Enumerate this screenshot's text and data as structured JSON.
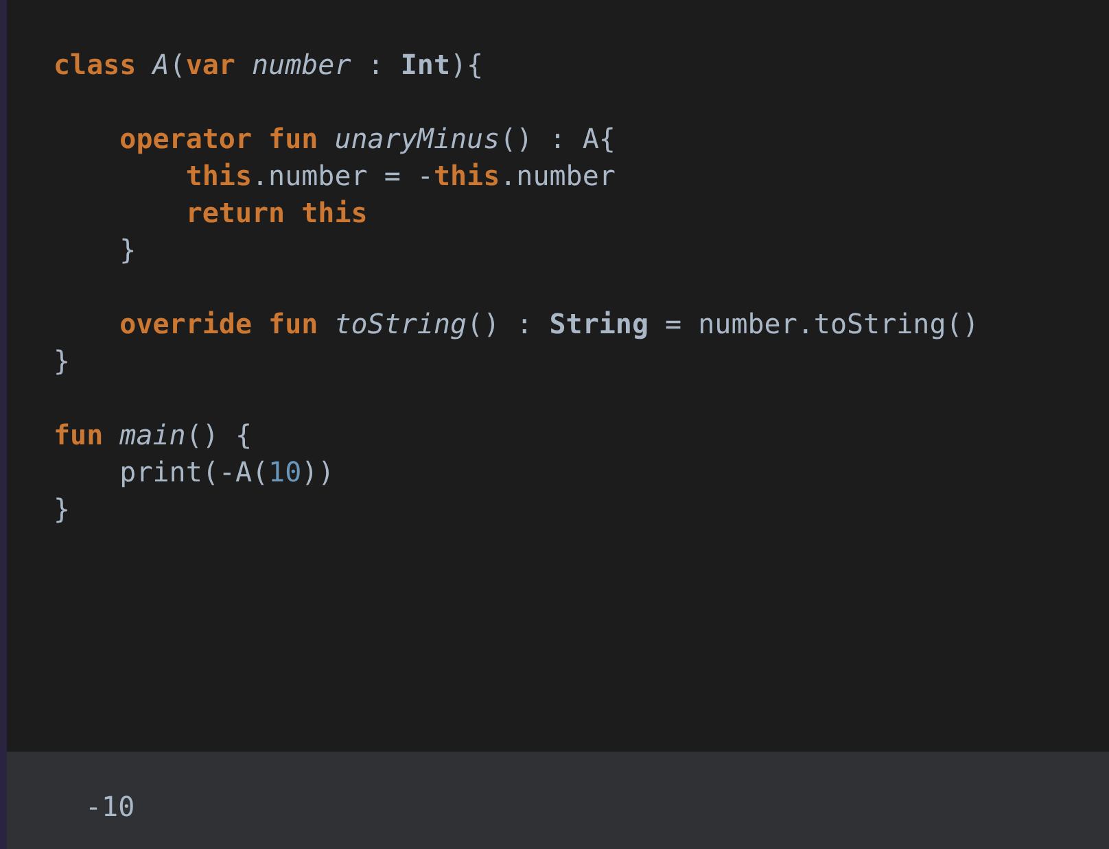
{
  "code": {
    "lines": [
      {
        "kind": "code",
        "tokens": [
          {
            "text": "class ",
            "kind": "keyword"
          },
          {
            "text": "A",
            "kind": "italic"
          },
          {
            "text": "(",
            "kind": "plain"
          },
          {
            "text": "var ",
            "kind": "keyword"
          },
          {
            "text": "number",
            "kind": "italic"
          },
          {
            "text": " : ",
            "kind": "plain"
          },
          {
            "text": "Int",
            "kind": "type"
          },
          {
            "text": "){",
            "kind": "plain"
          }
        ]
      },
      {
        "kind": "blank"
      },
      {
        "kind": "code",
        "tokens": [
          {
            "text": "    operator fun ",
            "kind": "keyword"
          },
          {
            "text": "unaryMinus",
            "kind": "italic"
          },
          {
            "text": "() : A{",
            "kind": "plain"
          }
        ]
      },
      {
        "kind": "code",
        "tokens": [
          {
            "text": "        this",
            "kind": "keyword"
          },
          {
            "text": ".number = -",
            "kind": "plain"
          },
          {
            "text": "this",
            "kind": "keyword"
          },
          {
            "text": ".number",
            "kind": "plain"
          }
        ]
      },
      {
        "kind": "code",
        "tokens": [
          {
            "text": "        return this",
            "kind": "keyword"
          }
        ]
      },
      {
        "kind": "code",
        "tokens": [
          {
            "text": "    }",
            "kind": "plain"
          }
        ]
      },
      {
        "kind": "blank"
      },
      {
        "kind": "code",
        "tokens": [
          {
            "text": "    override fun ",
            "kind": "keyword"
          },
          {
            "text": "toString",
            "kind": "italic"
          },
          {
            "text": "() : ",
            "kind": "plain"
          },
          {
            "text": "String",
            "kind": "type"
          },
          {
            "text": " = number.toString()",
            "kind": "plain"
          }
        ]
      },
      {
        "kind": "code",
        "tokens": [
          {
            "text": "}",
            "kind": "plain"
          }
        ]
      },
      {
        "kind": "blank"
      },
      {
        "kind": "code",
        "tokens": [
          {
            "text": "fun ",
            "kind": "keyword"
          },
          {
            "text": "main",
            "kind": "italic"
          },
          {
            "text": "() {",
            "kind": "plain"
          }
        ]
      },
      {
        "kind": "code",
        "tokens": [
          {
            "text": "    print(-A(",
            "kind": "plain"
          },
          {
            "text": "10",
            "kind": "number"
          },
          {
            "text": "))",
            "kind": "plain"
          }
        ]
      },
      {
        "kind": "code",
        "tokens": [
          {
            "text": "}",
            "kind": "plain"
          }
        ]
      }
    ]
  },
  "output": {
    "text": "-10"
  }
}
